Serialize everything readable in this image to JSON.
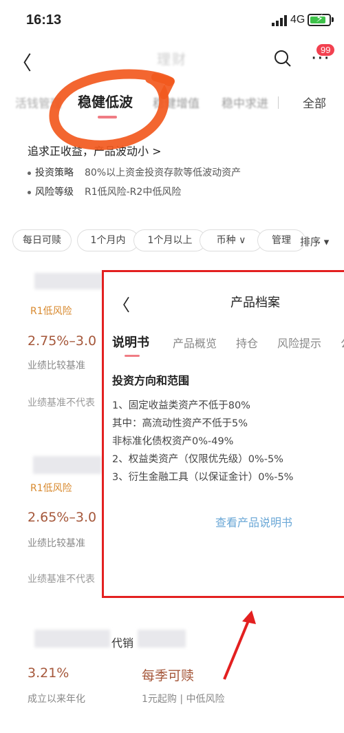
{
  "status": {
    "time": "16:13",
    "network": "4G"
  },
  "header": {
    "title": "理财",
    "badge": "99"
  },
  "tabs": [
    {
      "label": "活钱管理"
    },
    {
      "label": "稳健低波"
    },
    {
      "label": "稳健增值"
    },
    {
      "label": "稳中求进"
    },
    {
      "label": "全部"
    }
  ],
  "category": {
    "headline": "追求正收益，产品波动小 >",
    "rows": [
      {
        "key": "投资策略",
        "value": "80%以上资金投资存款等低波动资产"
      },
      {
        "key": "风险等级",
        "value": "R1低风险-R2中低风险"
      }
    ]
  },
  "filters": [
    "每日可赎",
    "1个月内",
    "1个月以上",
    "币种 ∨",
    "管理"
  ],
  "sort_label": "排序 ▾",
  "products": [
    {
      "risk": "R1低风险",
      "rate": "2.75%–3.0",
      "rate_label": "业绩比较基准",
      "disclaimer": "业绩基准不代表"
    },
    {
      "risk": "R1低风险",
      "rate": "2.65%–3.0",
      "rate_label": "业绩比较基准",
      "disclaimer": "业绩基准不代表"
    },
    {
      "name_suffix": "代销",
      "rate": "3.21%",
      "rate_label": "成立以来年化",
      "redeem": "每季可赎",
      "redeem_sub": "1元起购 | 中低风险"
    }
  ],
  "overlay": {
    "title": "产品档案",
    "tabs": [
      "说明书",
      "产品概览",
      "持仓",
      "风险提示",
      "公"
    ],
    "section_title": "投资方向和范围",
    "lines": [
      "1、固定收益类资产不低于80%",
      "其中：高流动性资产不低于5%",
      "非标准化债权资产0%-49%",
      "2、权益类资产（仅限优先级）0%-5%",
      "3、衍生金融工具（以保证金计）0%-5%"
    ],
    "link": "查看产品说明书"
  },
  "colors": {
    "accent": "#f07c84",
    "annotation": "#e32020",
    "brush": "#f2591e",
    "rate": "#a5573a",
    "risk": "#d8892e",
    "link": "#6aa7d6"
  }
}
